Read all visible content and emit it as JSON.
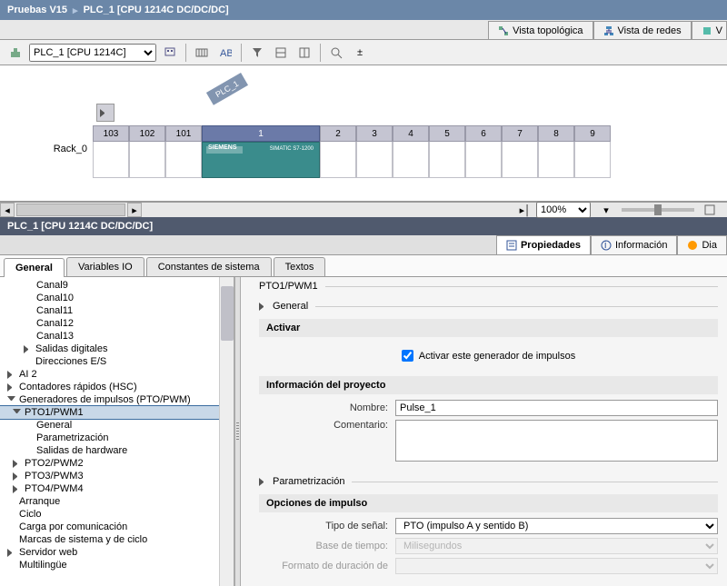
{
  "breadcrumb": {
    "project": "Pruebas V15",
    "device": "PLC_1 [CPU 1214C DC/DC/DC]"
  },
  "view_tabs": {
    "topologica": "Vista topológica",
    "redes": "Vista de redes",
    "partial": "V"
  },
  "toolbar": {
    "device_selector": "PLC_1 [CPU 1214C]"
  },
  "rack": {
    "label": "Rack_0",
    "plc_tag": "PLC_1",
    "cpu_brand": "SIEMENS",
    "cpu_model": "SIMATIC S7-1200",
    "slots": [
      "103",
      "102",
      "101",
      "1",
      "2",
      "3",
      "4",
      "5",
      "6",
      "7",
      "8",
      "9"
    ]
  },
  "zoom": {
    "value": "100%"
  },
  "prop_header": "PLC_1 [CPU 1214C DC/DC/DC]",
  "prop_tabs": {
    "propiedades": "Propiedades",
    "informacion": "Información",
    "diag_partial": "Dia"
  },
  "lower_tabs": {
    "general": "General",
    "variables": "Variables IO",
    "constantes": "Constantes de sistema",
    "textos": "Textos"
  },
  "tree": {
    "canal9": "Canal9",
    "canal10": "Canal10",
    "canal11": "Canal11",
    "canal12": "Canal12",
    "canal13": "Canal13",
    "salidas_dig": "Salidas digitales",
    "direcciones": "Direcciones E/S",
    "ai2": "AI 2",
    "contadores": "Contadores rápidos (HSC)",
    "generadores": "Generadores de impulsos (PTO/PWM)",
    "pto1": "PTO1/PWM1",
    "pto1_general": "General",
    "pto1_param": "Parametrización",
    "pto1_salidas": "Salidas de hardware",
    "pto2": "PTO2/PWM2",
    "pto3": "PTO3/PWM3",
    "pto4": "PTO4/PWM4",
    "arranque": "Arranque",
    "ciclo": "Ciclo",
    "carga_com": "Carga por comunicación",
    "marcas": "Marcas de sistema y de ciclo",
    "servidor_web": "Servidor web",
    "multi": "Multilingüe"
  },
  "props": {
    "pto_title": "PTO1/PWM1",
    "general": "General",
    "activar": "Activar",
    "activar_chk": "Activar este generador de impulsos",
    "info_proyecto": "Información del proyecto",
    "nombre_label": "Nombre:",
    "nombre_value": "Pulse_1",
    "comentario_label": "Comentario:",
    "parametrizacion": "Parametrización",
    "opciones": "Opciones de impulso",
    "tipo_senal_label": "Tipo de señal:",
    "tipo_senal_value": "PTO (impulso A y sentido B)",
    "base_tiempo_label": "Base de tiempo:",
    "base_tiempo_value": "Milisegundos",
    "formato_label": "Formato de duración de"
  }
}
